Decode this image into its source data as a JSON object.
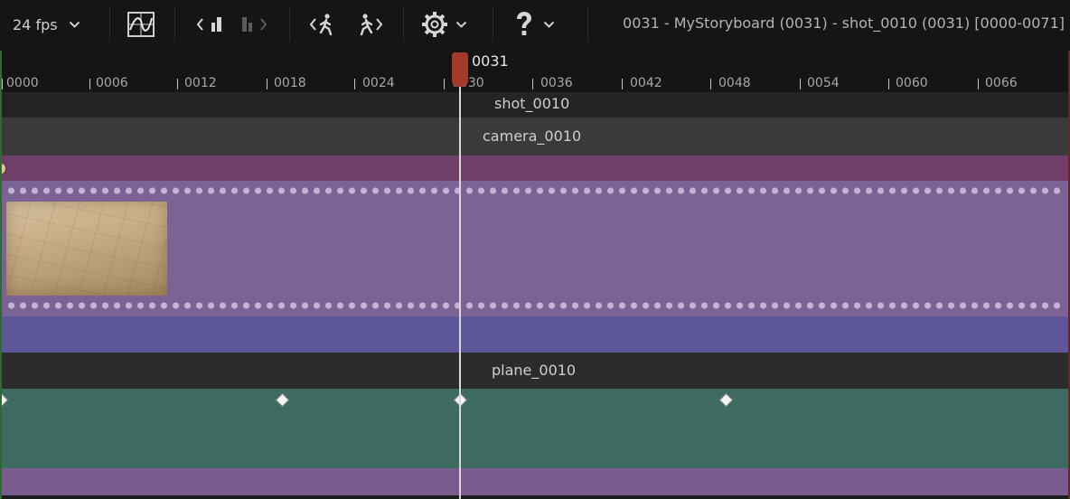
{
  "toolbar": {
    "fps_label": "24 fps",
    "title": "0031 - MyStoryboard (0031) - shot_0010 (0031) [0000-0071]",
    "icons": [
      "chevron-down-icon",
      "curve-editor-icon",
      "step-back-key-icon",
      "step-forward-key-icon",
      "walk-back-icon",
      "walk-forward-icon",
      "gear-icon",
      "chevron-down-icon",
      "help-icon",
      "chevron-down-icon"
    ]
  },
  "ruler": {
    "ticks": [
      "0000",
      "0006",
      "0012",
      "0018",
      "0024",
      "0030",
      "0036",
      "0042",
      "0048",
      "0054",
      "0060",
      "0066"
    ]
  },
  "playhead": {
    "frame": "0031"
  },
  "tracks": {
    "shot": "shot_0010",
    "camera": "camera_0010",
    "plane": "plane_0010"
  },
  "colors": {
    "background": "#151515",
    "playhead": "#a33a2c",
    "camera_track": "#6f3f6a",
    "filmstrip": "#7d6296",
    "blue_band": "#5d5699",
    "plane_track": "#3d6b62",
    "bottom_band": "#7a5b8e"
  }
}
